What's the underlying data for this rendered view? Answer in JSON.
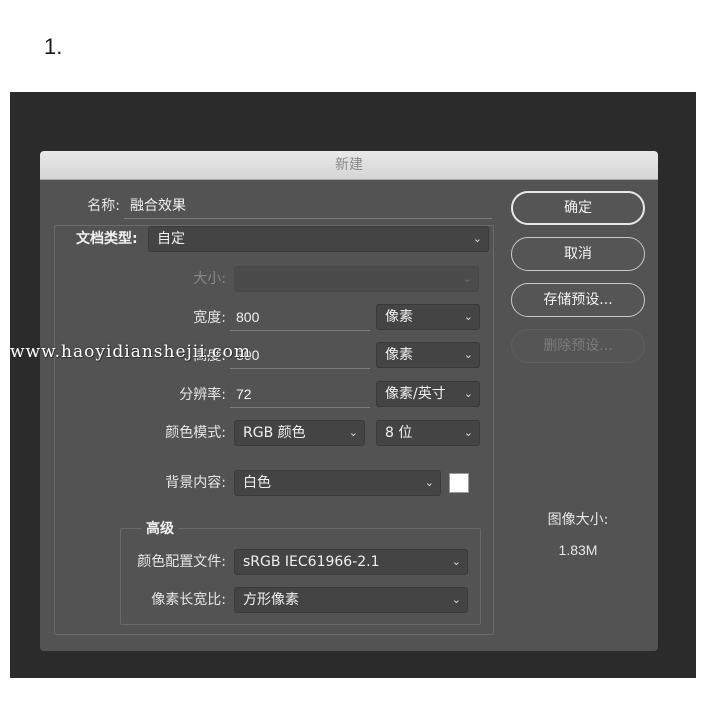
{
  "step_number": "1.",
  "dialog": {
    "title": "新建",
    "name_label": "名称:",
    "name_value": "融合效果",
    "doc_type_label": "文档类型:",
    "doc_type_value": "自定",
    "size_label": "大小:",
    "size_value": "",
    "width_label": "宽度:",
    "width_value": "800",
    "width_unit": "像素",
    "height_label": "高度:",
    "height_value": "800",
    "height_unit": "像素",
    "resolution_label": "分辨率:",
    "resolution_value": "72",
    "resolution_unit": "像素/英寸",
    "color_mode_label": "颜色模式:",
    "color_mode_value": "RGB 颜色",
    "bit_depth_value": "8 位",
    "background_label": "背景内容:",
    "background_value": "白色",
    "background_swatch_color": "#ffffff",
    "advanced_label": "高级",
    "color_profile_label": "颜色配置文件:",
    "color_profile_value": "sRGB IEC61966-2.1",
    "pixel_aspect_label": "像素长宽比:",
    "pixel_aspect_value": "方形像素",
    "buttons": {
      "ok": "确定",
      "cancel": "取消",
      "save_preset": "存储预设...",
      "delete_preset": "删除预设..."
    },
    "image_size_label": "图像大小:",
    "image_size_value": "1.83M"
  },
  "watermark": "www.haoyidianshejii.com"
}
